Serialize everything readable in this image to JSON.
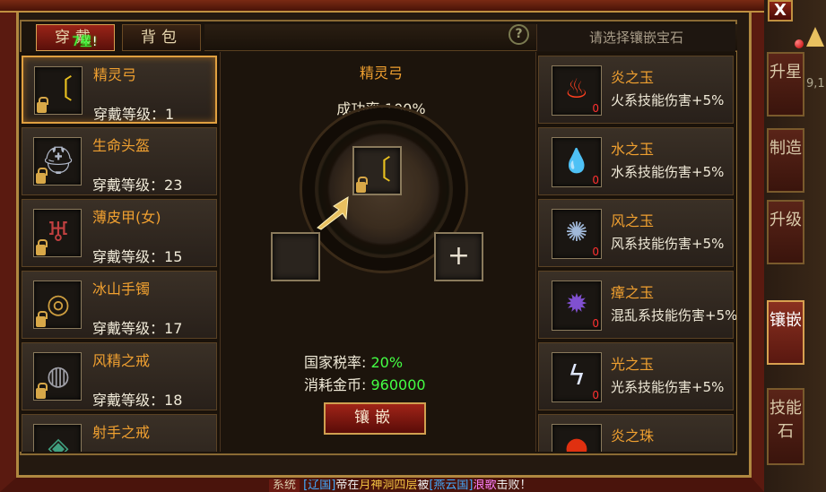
{
  "tabs": [
    {
      "label": "穿戴"
    },
    {
      "label": "背包"
    }
  ],
  "star_note": {
    "prefix": "",
    "green": "7星",
    "suffix": "!"
  },
  "help_label": "?",
  "right_hint": "请选择镶嵌宝石",
  "items": [
    {
      "name": "精灵弓",
      "level_label": "穿戴等级：",
      "level": "1",
      "icon": "bow-icon",
      "glyph": "〔"
    },
    {
      "name": "生命头盔",
      "level_label": "穿戴等级：",
      "level": "23",
      "icon": "helmet-icon",
      "glyph": "⛑"
    },
    {
      "name": "薄皮甲(女)",
      "level_label": "穿戴等级：",
      "level": "15",
      "icon": "armor-icon",
      "glyph": "♅"
    },
    {
      "name": "冰山手镯",
      "level_label": "穿戴等级：",
      "level": "17",
      "icon": "bracelet-icon",
      "glyph": "◎"
    },
    {
      "name": "风精之戒",
      "level_label": "穿戴等级：",
      "level": "18",
      "icon": "ring-icon",
      "glyph": "◍"
    },
    {
      "name": "射手之戒",
      "level_label": "穿戴等级：",
      "level": "",
      "icon": "ring-icon",
      "glyph": "◈"
    }
  ],
  "center": {
    "item_name": "精灵弓",
    "success_rate": "成功率:100%",
    "plus": "+",
    "tax_label": "国家税率:",
    "tax_value": "20%",
    "cost_label": "消耗金币:",
    "cost_value": "960000",
    "inlay_button": "镶嵌"
  },
  "gems": [
    {
      "name": "炎之玉",
      "effect": "火系技能伤害+5%",
      "count": "0",
      "icon": "fire-gem-icon",
      "glyph": "♨",
      "color": "#ff4020"
    },
    {
      "name": "水之玉",
      "effect": "水系技能伤害+5%",
      "count": "0",
      "icon": "water-gem-icon",
      "glyph": "💧",
      "color": "#3090ff"
    },
    {
      "name": "风之玉",
      "effect": "风系技能伤害+5%",
      "count": "0",
      "icon": "wind-gem-icon",
      "glyph": "✺",
      "color": "#a0b8d8"
    },
    {
      "name": "瘴之玉",
      "effect": "混乱系技能伤害+5%",
      "count": "0",
      "icon": "miasma-gem-icon",
      "glyph": "✹",
      "color": "#8050d0"
    },
    {
      "name": "光之玉",
      "effect": "光系技能伤害+5%",
      "count": "0",
      "icon": "light-gem-icon",
      "glyph": "ϟ",
      "color": "#e0e8ff"
    },
    {
      "name": "炎之珠",
      "effect": "",
      "count": "",
      "icon": "fire-pearl-icon",
      "glyph": "●",
      "color": "#e03010"
    }
  ],
  "side_tabs": [
    {
      "label": "升星"
    },
    {
      "label": "制造"
    },
    {
      "label": "升级"
    },
    {
      "label": "镶嵌"
    },
    {
      "label": "技能石"
    }
  ],
  "close_label": "X",
  "coord_text": "9,1",
  "news": {
    "tag": "系统",
    "a": "[辽国]",
    "b": "帝在",
    "c": "月神洞四层",
    "d": "被",
    "e": "[燕云国]",
    "f": "浪歌",
    "g": "击败！"
  }
}
